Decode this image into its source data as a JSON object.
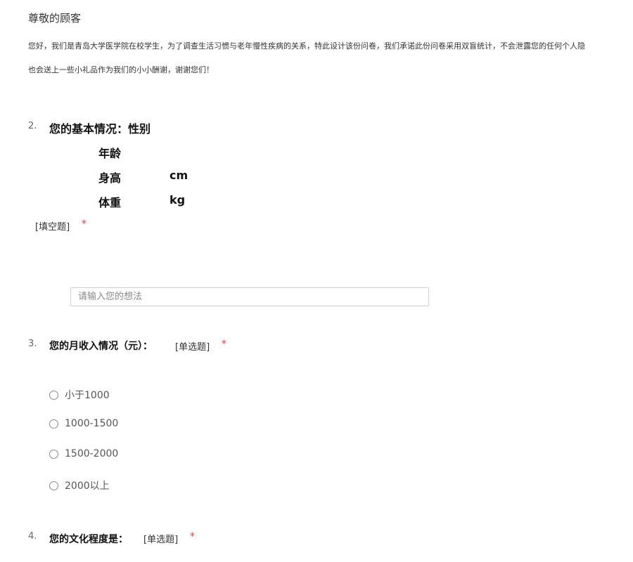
{
  "header": {
    "greeting": "尊敬的顾客",
    "intro_line1": "您好，我们是青岛大学医学院在校学生，为了调查生活习惯与老年慢性疾病的关系，特此设计该份问卷，我们承诺此份问卷采用双盲统计，不会泄露您的任何个人隐",
    "intro_line2": "也会送上一些小礼品作为我们的小小酬谢，谢谢您们！"
  },
  "q2": {
    "number": "2.",
    "title": "您的基本情况：性别",
    "age_label": "年龄",
    "height_label": "身高",
    "height_unit": "cm",
    "weight_label": "体重",
    "weight_unit": "kg",
    "type": "[填空题]",
    "required_mark": "*",
    "input_placeholder": "请输入您的想法"
  },
  "q3": {
    "number": "3.",
    "title": "您的月收入情况（元）：",
    "type": "[单选题]",
    "required_mark": "*",
    "options": [
      "小于1000",
      "1000-1500",
      "1500-2000",
      "2000以上"
    ]
  },
  "q4": {
    "number": "4.",
    "title": "您的文化程度是：",
    "type": "[单选题]",
    "required_mark": "*"
  },
  "colors": {
    "required": "#e4393c",
    "text": "#333333"
  }
}
